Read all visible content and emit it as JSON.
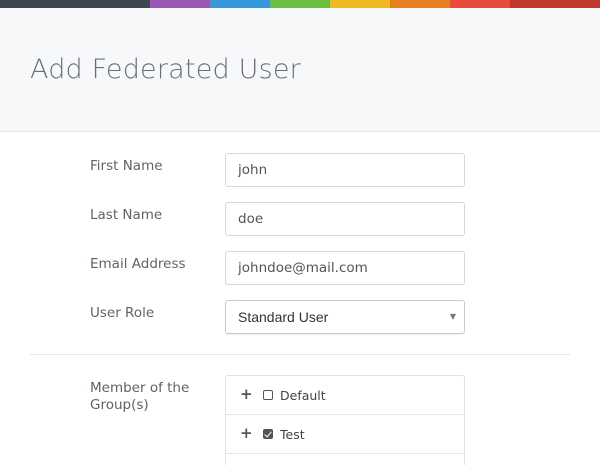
{
  "brand_colors": [
    "#3e4654",
    "#9b59b6",
    "#3498db",
    "#6abf40",
    "#f1b823",
    "#e67e22",
    "#e74c3c",
    "#c0392b"
  ],
  "page": {
    "title": "Add Federated User"
  },
  "form": {
    "first_name": {
      "label": "First Name",
      "value": "john"
    },
    "last_name": {
      "label": "Last Name",
      "value": "doe"
    },
    "email": {
      "label": "Email Address",
      "value": "johndoe@mail.com"
    },
    "role": {
      "label": "User Role",
      "selected": "Standard User"
    },
    "groups": {
      "label": "Member of the Group(s)",
      "items": [
        {
          "name": "Default",
          "checked": false
        },
        {
          "name": "Test",
          "checked": true
        }
      ]
    }
  }
}
